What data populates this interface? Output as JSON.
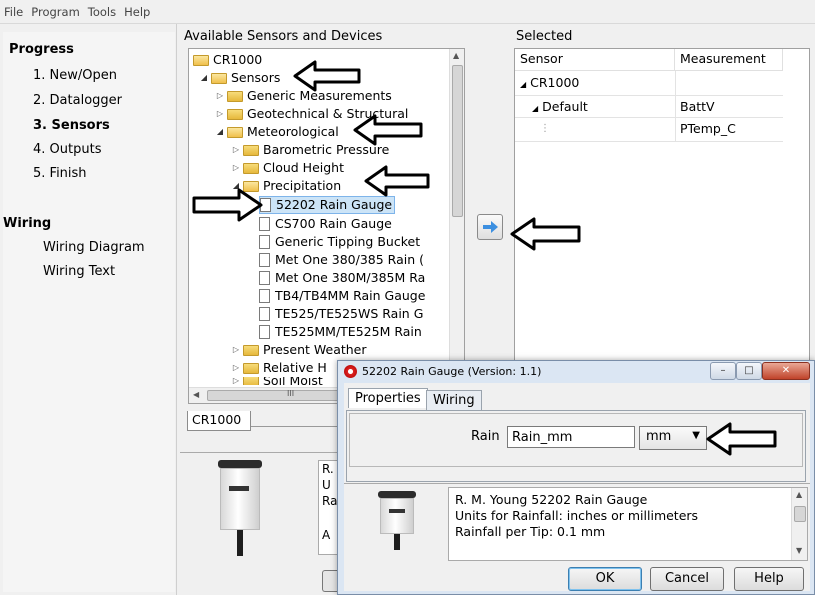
{
  "menu": [
    "File",
    "Program",
    "Tools",
    "Help"
  ],
  "nav": {
    "progress_title": "Progress",
    "steps": [
      "1. New/Open",
      "2. Datalogger",
      "3. Sensors",
      "4. Outputs",
      "5. Finish"
    ],
    "active_step": "3. Sensors",
    "wiring_title": "Wiring",
    "wiring_items": [
      "Wiring Diagram",
      "Wiring Text"
    ]
  },
  "available": {
    "label": "Available Sensors and Devices",
    "root": "CR1000",
    "sensors": "Sensors",
    "generic": "Generic Measurements",
    "geotech": "Geotechnical & Structural",
    "meteo": "Meteorological",
    "baro": "Barometric Pressure",
    "cloud": "Cloud Height",
    "precip": "Precipitation",
    "items": [
      "52202 Rain Gauge",
      "CS700 Rain Gauge",
      "Generic Tipping Bucket",
      "Met One 380/385 Rain (",
      "Met One 380M/385M Ra",
      "TB4/TB4MM Rain Gauge",
      "TE525/TE525WS Rain G",
      "TE525MM/TE525M Rain"
    ],
    "present_weather": "Present Weather",
    "relative": "Relative H",
    "soil": "Soil Moist",
    "scroll_glyph": "III",
    "tab": "CR1000"
  },
  "selected": {
    "label": "Selected",
    "col_sensor": "Sensor",
    "col_measurement": "Measurement",
    "rows": [
      {
        "sensor": "CR1000",
        "measurement": ""
      },
      {
        "sensor": "Default",
        "measurement": "BattV"
      },
      {
        "sensor": "",
        "measurement": "PTemp_C"
      }
    ]
  },
  "bg_desc": {
    "l1": "R.",
    "l2": "U",
    "l3": "Ra",
    "l4": "A"
  },
  "dialog": {
    "title": "52202 Rain Gauge (Version: 1.1)",
    "tabs": [
      "Properties",
      "Wiring"
    ],
    "field_label": "Rain",
    "field_value": "Rain_mm",
    "unit": "mm",
    "desc1": "R. M. Young 52202 Rain Gauge",
    "desc2": "Units for Rainfall: inches or millimeters",
    "desc3": "Rainfall per Tip: 0.1 mm",
    "ok": "OK",
    "cancel": "Cancel",
    "help": "Help"
  },
  "icons": {
    "add_button": "arrow-right-icon",
    "annotation": "outline-arrow-icon"
  },
  "colors": {
    "selected_row": "#cce4f7",
    "add_button": "#3c8fe0"
  }
}
